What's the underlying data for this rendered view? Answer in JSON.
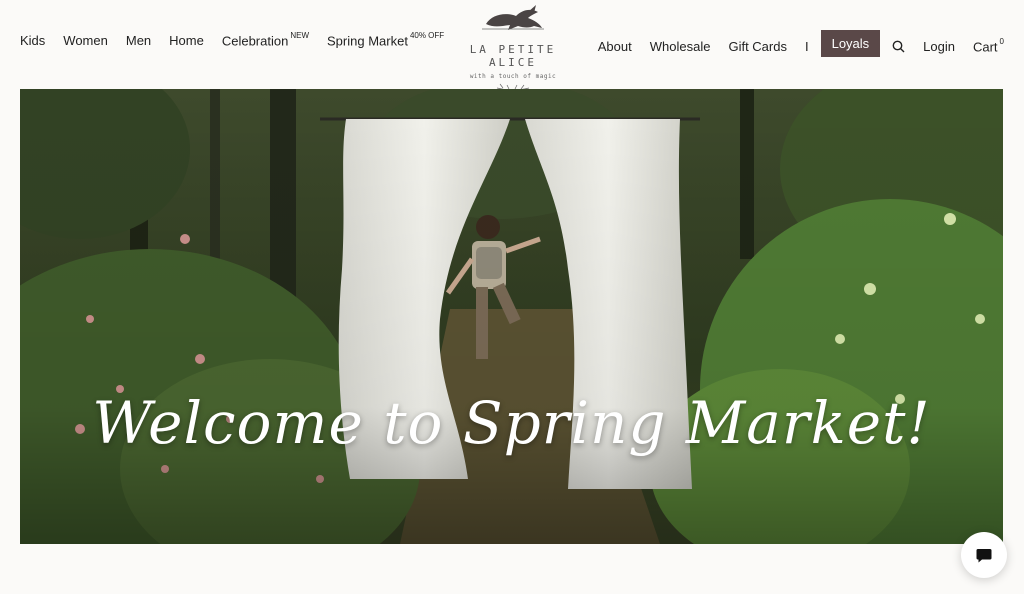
{
  "brand": {
    "name": "LA PETITE ALICE",
    "tagline": "with a touch of magic"
  },
  "nav_left": [
    {
      "label": "Kids"
    },
    {
      "label": "Women"
    },
    {
      "label": "Men"
    },
    {
      "label": "Home"
    },
    {
      "label": "Celebration",
      "badge": "NEW"
    },
    {
      "label": "Spring Market",
      "badge": "40% OFF"
    }
  ],
  "nav_right": {
    "about": "About",
    "wholesale": "Wholesale",
    "gift_cards": "Gift Cards",
    "divider": "I",
    "loyals": "Loyals",
    "login": "Login",
    "cart": "Cart",
    "cart_count": "0"
  },
  "hero": {
    "title": "Welcome to Spring Market!"
  },
  "icons": {
    "search": "search-icon",
    "chat": "chat-icon",
    "logo": "hare-logo-icon"
  },
  "colors": {
    "background": "#fbfaf8",
    "loyals_button": "#5a4848"
  }
}
